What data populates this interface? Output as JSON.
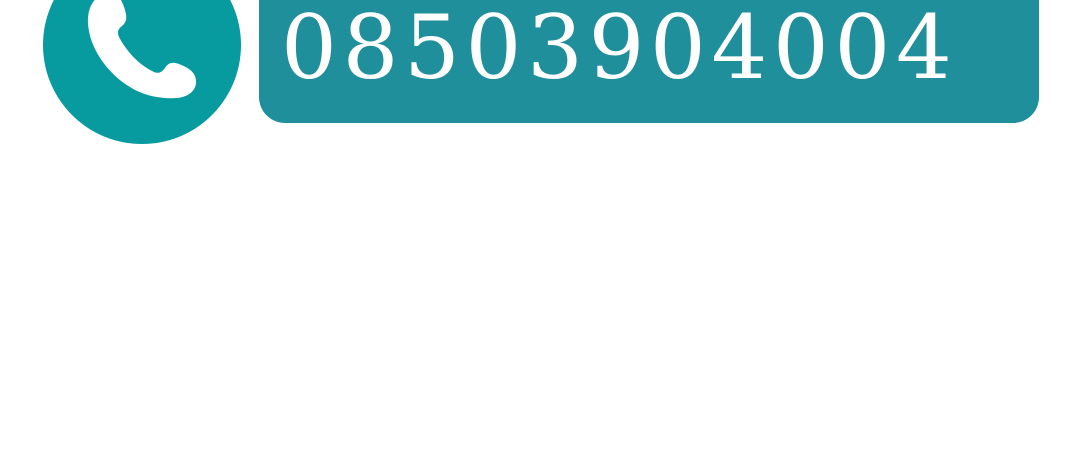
{
  "call_widget": {
    "icon": "phone-handset-icon",
    "phone_number": "08503904004",
    "colors": {
      "icon_circle": "#079a9f",
      "number_background": "#1f8f9b",
      "text": "#ffffff"
    }
  }
}
